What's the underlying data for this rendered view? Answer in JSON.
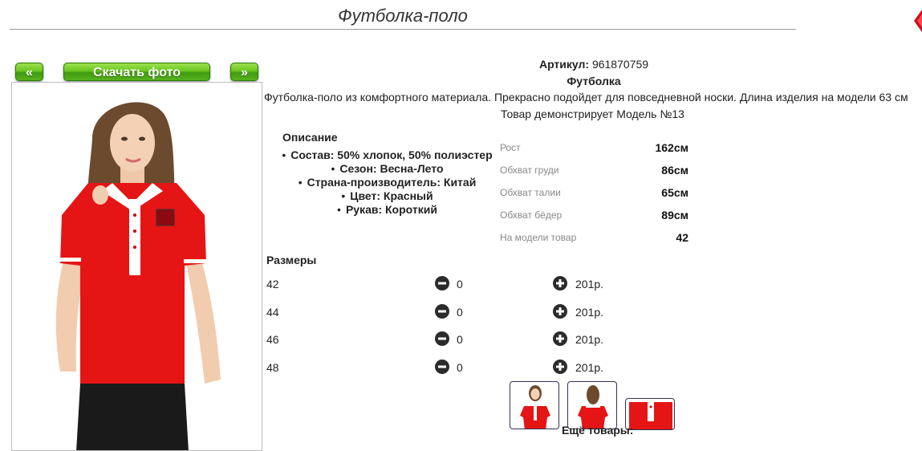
{
  "page": {
    "title": "Футболка-поло"
  },
  "gallery": {
    "prev_label": "«",
    "download_label": "Скачать фото",
    "next_label": "»"
  },
  "product": {
    "sku_label": "Артикул:",
    "sku_value": "961870759",
    "category": "Футболка",
    "description": "Футболка-поло из комфортного материала. Прекрасно подойдет для повседневной носки. Длина изделия на модели 63 см",
    "model_note": "Товар демонстрирует Модель №13"
  },
  "description_block": {
    "title": "Описание",
    "attributes": [
      "Состав: 50% хлопок, 50% полиэстер",
      "Сезон: Весна-Лето",
      "Страна-производитель: Китай",
      "Цвет: Красный",
      "Рукав: Короткий"
    ]
  },
  "measurements": [
    {
      "label": "Рост",
      "value": "162см"
    },
    {
      "label": "Обхват груди",
      "value": "86см"
    },
    {
      "label": "Обхват талии",
      "value": "65см"
    },
    {
      "label": "Обхват бёдер",
      "value": "89см"
    },
    {
      "label": "На модели товар",
      "value": "42"
    }
  ],
  "sizes": {
    "title": "Размеры",
    "rows": [
      {
        "size": "42",
        "qty": "0",
        "price": "201р."
      },
      {
        "size": "44",
        "qty": "0",
        "price": "201р."
      },
      {
        "size": "46",
        "qty": "0",
        "price": "201р."
      },
      {
        "size": "48",
        "qty": "0",
        "price": "201р."
      }
    ]
  },
  "more": {
    "title": "Ещё товары:"
  },
  "icons": {
    "close": "close-icon",
    "minus": "minus-circle-icon",
    "plus": "plus-circle-icon"
  },
  "colors": {
    "accent_green": "#5cb81c",
    "shirt_red": "#e51515",
    "close_red": "#d0101a"
  }
}
